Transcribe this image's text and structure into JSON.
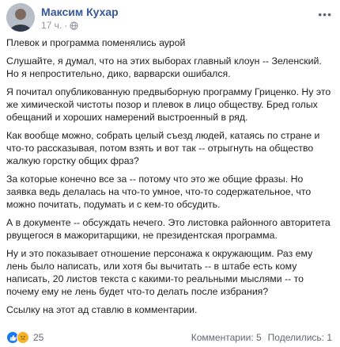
{
  "post": {
    "author": "Максим Кухар",
    "time": "17 ч.",
    "more_icon": "ellipsis-icon",
    "privacy_icon": "globe-icon",
    "paragraphs": [
      "Плевок и программа поменялись аурой",
      "Слушайте, я думал, что на этих выборах главный клоун -- Зеленский. Но я непростительно, дико, варварски ошибался.",
      "Я почитал опубликованную предвыборную программу Гриценко. Ну это же химической чистоты позор и плевок в лицо обществу. Бред голых обещаний и хороших намерений выстроенный в ряд.",
      "Как вообще можно, собрать целый съезд людей, катаясь по стране и что-то рассказывая, потом взять и вот так -- отрыгнуть на общество жалкую горстку общих фраз?",
      "За которые конечно все за -- потому что это же общие фразы. Но заявка ведь делалась на что-то умное, что-то содержательное, что можно почитать, подумать и с кем-то обсудить.",
      "А в документе -- обсуждать нечего. Это листовка районного авторитета рвущегося в мажоритарщики, не президентская программа.",
      "Ну и это показывает отношение персонажа к окружающим. Раз ему лень было написать, или хотя бы вычитать -- в штабе есть кому написать, 20 листов текста с какими-то реальными мыслями -- то почему ему не лень будет что-то делать после избрания?",
      "Ссылку на этот ад ставлю в комментарии."
    ],
    "reactions_count": "25",
    "reactions": [
      {
        "icon": "like-icon",
        "color": "#1877f2"
      },
      {
        "icon": "sad-icon",
        "color": "#f7b125"
      }
    ],
    "comments": "Комментарии: 5",
    "shares": "Поделились: 1"
  }
}
